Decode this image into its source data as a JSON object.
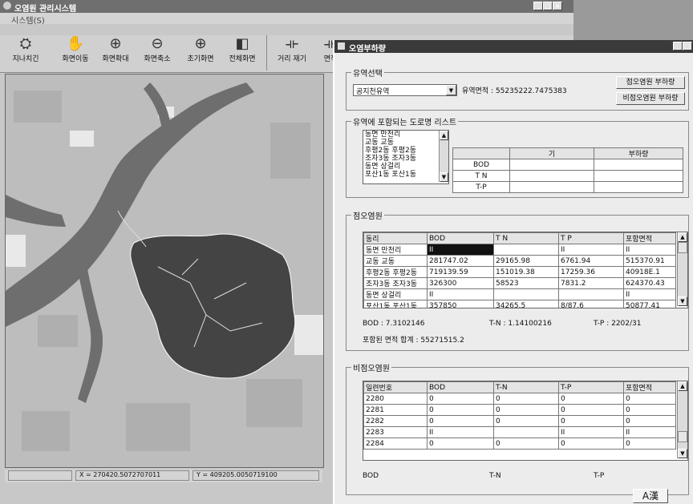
{
  "main_window": {
    "title": "오염원 관리시스템",
    "menu": "시스템(S)",
    "toolbar": [
      {
        "label": "지나치긴",
        "icon": "globe-icon",
        "glyph": "⛭"
      },
      {
        "label": "화면이동",
        "icon": "hand-icon",
        "glyph": "✋"
      },
      {
        "label": "화면확대",
        "icon": "zoom-in-icon",
        "glyph": "⊕"
      },
      {
        "label": "화면축소",
        "icon": "zoom-out-icon",
        "glyph": "⊖"
      },
      {
        "label": "초기화면",
        "icon": "zoom-reset-icon",
        "glyph": "⊕"
      },
      {
        "label": "전체화면",
        "icon": "full-extent-icon",
        "glyph": "◧"
      },
      {
        "label": "거리 재기",
        "icon": "measure-icon",
        "glyph": "⟛"
      },
      {
        "label": "면적",
        "icon": "area-icon",
        "glyph": "⟛"
      }
    ],
    "status_x": "X = 270420.5072707011",
    "status_y": "Y = 409205.0050719100"
  },
  "dialog": {
    "title": "오염부하량",
    "watershed_section": {
      "label": "유역선택",
      "selected": "공지천유역",
      "area_text": "유역면적 : 55235222.7475383",
      "btn_point": "점오염원 부하량",
      "btn_nonpoint": "비점오염원 부하량"
    },
    "district_section": {
      "label": "유역에 포함되는 도로명 리스트",
      "list": [
        "동면 만천리",
        "교동 교동",
        "후평2동 후평2동",
        "조자3동 조자3동",
        "동면 상걸리",
        "포산1동 포산1동"
      ],
      "headers": [
        "",
        "기",
        "부하량"
      ],
      "rows": [
        "BOD",
        "T N",
        "T-P"
      ]
    },
    "point_section": {
      "label": "점오염원",
      "headers": [
        "동리",
        "BOD",
        "T N",
        "T P",
        "포함면적"
      ],
      "rows": [
        [
          "동면 만천리",
          "II",
          "",
          "II",
          "II"
        ],
        [
          "교동 교동",
          "281747.02",
          "29165.98",
          "6761.94",
          "515370.91"
        ],
        [
          "후평2동 후평2동",
          "719139.59",
          "151019.38",
          "17259.36",
          "40918E.1"
        ],
        [
          "조자3동 조자3동",
          "326300",
          "58523",
          "7831.2",
          "624370.43"
        ],
        [
          "동면 상걸리",
          "II",
          "",
          "",
          "II"
        ],
        [
          "포산1동 포산1동",
          "357850",
          "34265.5",
          "8/87.6",
          "50877.41"
        ]
      ],
      "sum_bod": "BOD : 7.3102146",
      "sum_tn": "T-N : 1.14100216",
      "sum_tp": "T-P : 2202/31",
      "area_sum": "포함된 면적 합계 : 55271515.2"
    },
    "nonpoint_section": {
      "label": "비점오염원",
      "headers": [
        "일련번호",
        "BOD",
        "T-N",
        "T-P",
        "포함면적"
      ],
      "rows": [
        [
          "2280",
          "0",
          "0",
          "0",
          "0"
        ],
        [
          "2281",
          "0",
          "0",
          "0",
          "0"
        ],
        [
          "2282",
          "0",
          "0",
          "0",
          "0"
        ],
        [
          "2283",
          "II",
          "",
          "II",
          "II"
        ],
        [
          "2284",
          "0",
          "0",
          "0",
          "0"
        ]
      ],
      "bod": "BOD",
      "tn": "T-N",
      "tp": "T-P"
    },
    "ime_indicator": "A漢"
  }
}
